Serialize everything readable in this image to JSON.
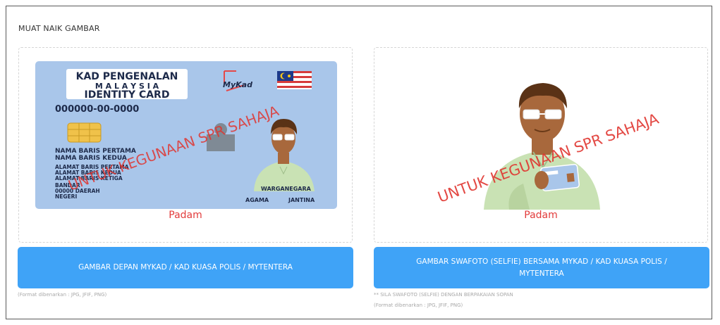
{
  "section_title": "MUAT NAIK GAMBAR",
  "left_upload": {
    "card": {
      "title_line1": "KAD PENGENALAN",
      "title_line2": "M A L A Y S I A",
      "title_line3": "IDENTITY CARD",
      "brand": "MyKad",
      "ic_number": "000000-00-0000",
      "name_line1": "NAMA BARIS PERTAMA",
      "name_line2": "NAMA BARIS KEDUA",
      "address_line1": "ALAMAT BARIS PERTAMA",
      "address_line2": "ALAMAT BARIS KEDUA",
      "address_line3": "ALAMAT BARIS KETIGA",
      "bandar": "BANDAR",
      "postcode": "00000 DAERAH",
      "negeri": "NEGERI",
      "citizenship": "WARGANEGARA",
      "religion": "AGAMA",
      "gender": "JANTINA"
    },
    "watermark": "UNTUK KEGUNAAN SPR SAHAJA",
    "delete_label": "Padam",
    "button_label": "GAMBAR DEPAN MYKAD / KAD KUASA POLIS / MYTENTERA",
    "format_note": "(Format dibenarkan : JPG, JFIF, PNG)"
  },
  "right_upload": {
    "watermark": "UNTUK KEGUNAAN SPR SAHAJA",
    "delete_label": "Padam",
    "button_label": "GAMBAR SWAFOTO (SELFIE) BERSAMA MYKAD / KAD KUASA POLIS / MYTENTERA",
    "attire_note": "** SILA SWAFOTO (SELFIE) DENGAN BERPAKAIAN SOPAN",
    "format_note": "(Format dibenarkan : JPG, JFIF, PNG)"
  },
  "colors": {
    "button": "#3fa3f7",
    "delete": "#e23b3b",
    "card": "#a9c6ea",
    "watermark": "#e0342f"
  }
}
